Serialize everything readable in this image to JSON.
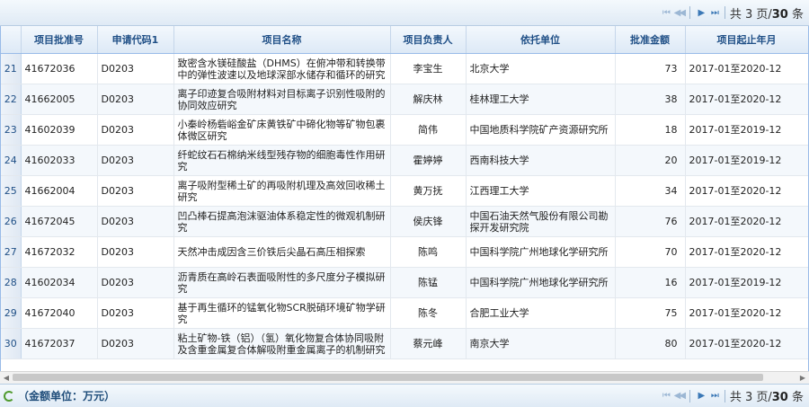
{
  "pager": {
    "first": "⏮",
    "prev": "◀◀",
    "next": "▶",
    "last": "⏭",
    "text_prefix": "共 3 页/",
    "total": "30",
    "text_suffix": " 条"
  },
  "columns": [
    "项目批准号",
    "申请代码1",
    "项目名称",
    "项目负责人",
    "依托单位",
    "批准金额",
    "项目起止年月"
  ],
  "rows": [
    {
      "n": "21",
      "id": "41672036",
      "code": "D0203",
      "title": "致密含水镁硅酸盐（DHMS）在俯冲带和转换带中的弹性波速以及地球深部水储存和循环的研究",
      "pi": "李宝生",
      "org": "北京大学",
      "amt": "73",
      "period": "2017-01至2020-12"
    },
    {
      "n": "22",
      "id": "41662005",
      "code": "D0203",
      "title": "离子印迹复合吸附材料对目标离子识别性吸附的协同效应研究",
      "pi": "解庆林",
      "org": "桂林理工大学",
      "amt": "38",
      "period": "2017-01至2020-12"
    },
    {
      "n": "23",
      "id": "41602039",
      "code": "D0203",
      "title": "小秦岭杨砦峪金矿床黄铁矿中碲化物等矿物包裹体微区研究",
      "pi": "简伟",
      "org": "中国地质科学院矿产资源研究所",
      "amt": "18",
      "period": "2017-01至2019-12"
    },
    {
      "n": "24",
      "id": "41602033",
      "code": "D0203",
      "title": "纤蛇纹石石棉纳米线型残存物的细胞毒性作用研究",
      "pi": "霍婷婷",
      "org": "西南科技大学",
      "amt": "20",
      "period": "2017-01至2019-12"
    },
    {
      "n": "25",
      "id": "41662004",
      "code": "D0203",
      "title": "离子吸附型稀土矿的再吸附机理及高效回收稀土研究",
      "pi": "黄万抚",
      "org": "江西理工大学",
      "amt": "34",
      "period": "2017-01至2020-12"
    },
    {
      "n": "26",
      "id": "41672045",
      "code": "D0203",
      "title": "凹凸棒石提高泡沫驱油体系稳定性的微观机制研究",
      "pi": "侯庆锋",
      "org": "中国石油天然气股份有限公司勘探开发研究院",
      "amt": "76",
      "period": "2017-01至2020-12"
    },
    {
      "n": "27",
      "id": "41672032",
      "code": "D0203",
      "title": "天然冲击成因含三价铁后尖晶石高压相探索",
      "pi": "陈鸣",
      "org": "中国科学院广州地球化学研究所",
      "amt": "70",
      "period": "2017-01至2020-12"
    },
    {
      "n": "28",
      "id": "41602034",
      "code": "D0203",
      "title": "沥青质在高岭石表面吸附性的多尺度分子模拟研究",
      "pi": "陈锰",
      "org": "中国科学院广州地球化学研究所",
      "amt": "16",
      "period": "2017-01至2019-12"
    },
    {
      "n": "29",
      "id": "41672040",
      "code": "D0203",
      "title": "基于再生循环的锰氧化物SCR脱硝环境矿物学研究",
      "pi": "陈冬",
      "org": "合肥工业大学",
      "amt": "75",
      "period": "2017-01至2020-12"
    },
    {
      "n": "30",
      "id": "41672037",
      "code": "D0203",
      "title": "粘土矿物-铁（铝）（氢）氧化物复合体协同吸附及含重金属复合体解吸附重金属离子的机制研究",
      "pi": "蔡元峰",
      "org": "南京大学",
      "amt": "80",
      "period": "2017-01至2020-12"
    }
  ],
  "footer": {
    "note": "（金额单位：万元）"
  }
}
